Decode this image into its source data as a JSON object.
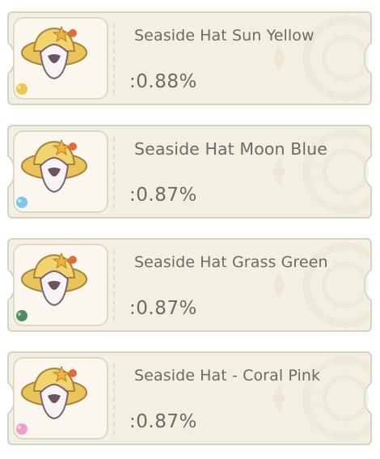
{
  "items": [
    {
      "name": "Seaside Hat Sun Yellow",
      "rate": ":0.88%",
      "dye_icon": "dye-drop-icon",
      "dye_color": "#f3c44a"
    },
    {
      "name": "Seaside Hat Moon Blue",
      "rate": ":0.87%",
      "dye_icon": "dye-drop-icon",
      "dye_color": "#7fc7ea"
    },
    {
      "name": "Seaside Hat Grass Green",
      "rate": ":0.87%",
      "dye_icon": "dye-drop-icon",
      "dye_color": "#4f8f5e"
    },
    {
      "name": "Seaside Hat - Coral Pink",
      "rate": ":0.87%",
      "dye_icon": "dye-drop-icon",
      "dye_color": "#f29bc6"
    }
  ],
  "colors": {
    "card_bg": "#f4efe3",
    "card_border": "#d9d2c1",
    "text": "#6f6a63"
  }
}
